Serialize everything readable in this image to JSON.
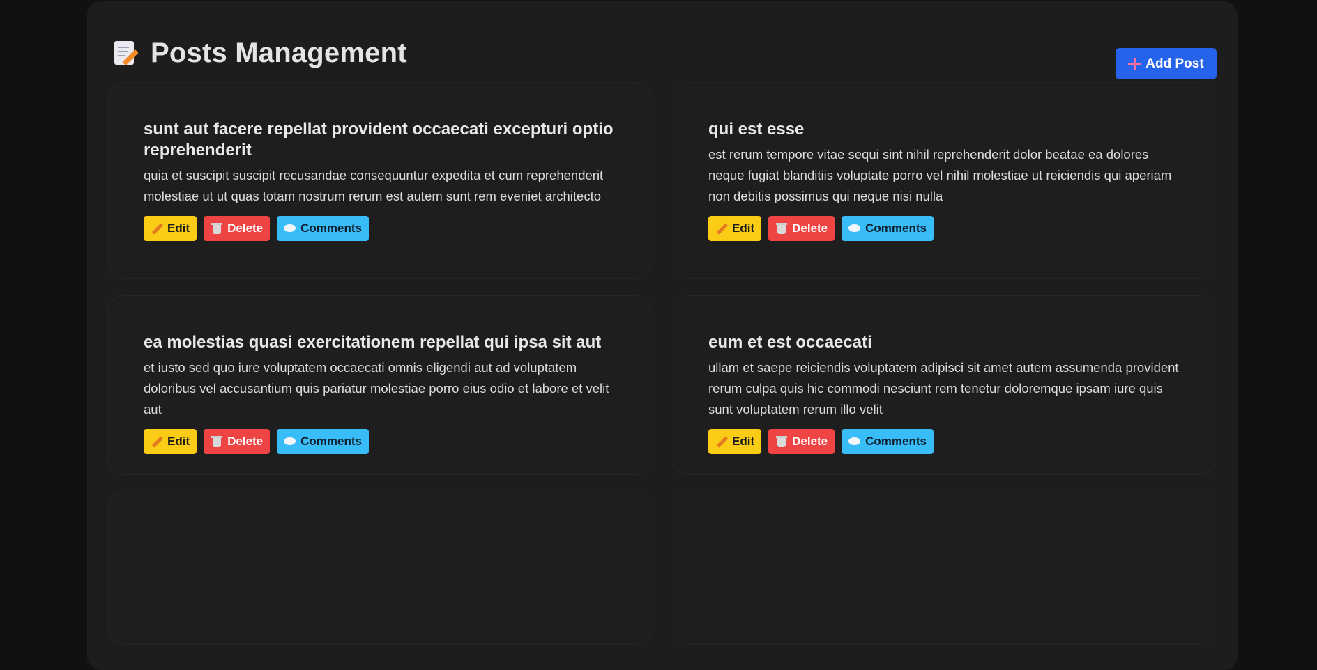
{
  "header": {
    "title": "Posts Management",
    "title_icon": "memo-icon",
    "add_button_label": "Add Post"
  },
  "colors": {
    "background": "#111111",
    "panel": "#1d1d1d",
    "primary": "#2563eb",
    "edit": "#facc15",
    "delete": "#ef4444",
    "comments": "#38bdf8"
  },
  "posts": [
    {
      "title": "sunt aut facere repellat provident occaecati excepturi optio reprehenderit",
      "body": "quia et suscipit suscipit recusandae consequuntur expedita et cum reprehenderit molestiae ut ut quas totam nostrum rerum est autem sunt rem eveniet architecto",
      "edit_label": "Edit",
      "delete_label": "Delete",
      "comments_label": "Comments"
    },
    {
      "title": "qui est esse",
      "body": "est rerum tempore vitae sequi sint nihil reprehenderit dolor beatae ea dolores neque fugiat blanditiis voluptate porro vel nihil molestiae ut reiciendis qui aperiam non debitis possimus qui neque nisi nulla",
      "edit_label": "Edit",
      "delete_label": "Delete",
      "comments_label": "Comments"
    },
    {
      "title": "ea molestias quasi exercitationem repellat qui ipsa sit aut",
      "body": "et iusto sed quo iure voluptatem occaecati omnis eligendi aut ad voluptatem doloribus vel accusantium quis pariatur molestiae porro eius odio et labore et velit aut",
      "edit_label": "Edit",
      "delete_label": "Delete",
      "comments_label": "Comments"
    },
    {
      "title": "eum et est occaecati",
      "body": "ullam et saepe reiciendis voluptatem adipisci sit amet autem assumenda provident rerum culpa quis hic commodi nesciunt rem tenetur doloremque ipsam iure quis sunt voluptatem rerum illo velit",
      "edit_label": "Edit",
      "delete_label": "Delete",
      "comments_label": "Comments"
    }
  ]
}
